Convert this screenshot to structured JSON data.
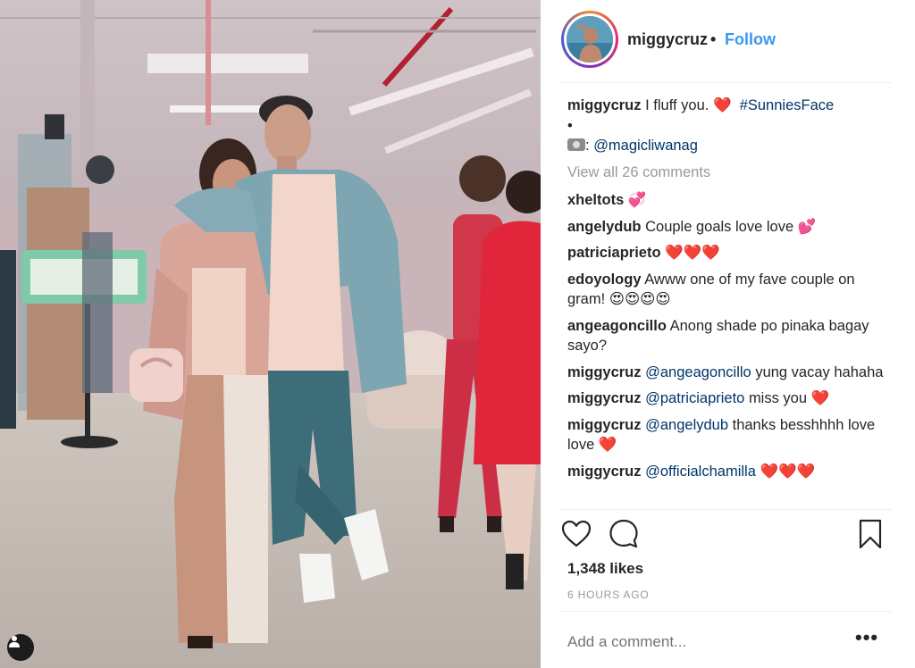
{
  "post": {
    "username": "miggycruz",
    "dot": "•",
    "follow_label": "Follow"
  },
  "caption": {
    "username": "miggycruz",
    "text": "I fluff you.",
    "heart": "❤️",
    "hashtag": "#SunniesFace",
    "bullet": "•",
    "camera_icon": "camera-emoji",
    "credit_sep": ":",
    "credit_mention": "@magicliwanag"
  },
  "view_all": "View all 26 comments",
  "comments": [
    {
      "user": "xheltots",
      "text": "",
      "emoji": "💞"
    },
    {
      "user": "angelydub",
      "text": "Couple goals love love",
      "emoji": "💕"
    },
    {
      "user": "patriciaprieto",
      "text": "",
      "emoji": "❤️❤️❤️"
    },
    {
      "user": "edoyology",
      "text": "Awww one of my fave couple on gram!",
      "emoji": "😍😍😍😍"
    },
    {
      "user": "angeagoncillo",
      "text": "Anong shade po pinaka bagay sayo?",
      "emoji": ""
    },
    {
      "user": "miggycruz",
      "mention": "@angeagoncillo",
      "text": "yung vacay hahaha",
      "emoji": ""
    },
    {
      "user": "miggycruz",
      "mention": "@patriciaprieto",
      "text": "miss you",
      "emoji": "❤️"
    },
    {
      "user": "miggycruz",
      "mention": "@angelydub",
      "text": "thanks besshhhh love love",
      "emoji": "❤️"
    },
    {
      "user": "miggycruz",
      "mention": "@officialchamilla",
      "text": "",
      "emoji": "❤️❤️❤️"
    }
  ],
  "actions": {
    "like_icon": "heart-outline-icon",
    "comment_icon": "comment-bubble-icon",
    "save_icon": "bookmark-icon"
  },
  "likes": "1,348 likes",
  "timestamp": "6 HOURS AGO",
  "add_comment_placeholder": "Add a comment...",
  "more_label": "•••",
  "colors": {
    "link": "#003569",
    "follow": "#3897f0",
    "muted": "#999999",
    "text": "#262626"
  }
}
